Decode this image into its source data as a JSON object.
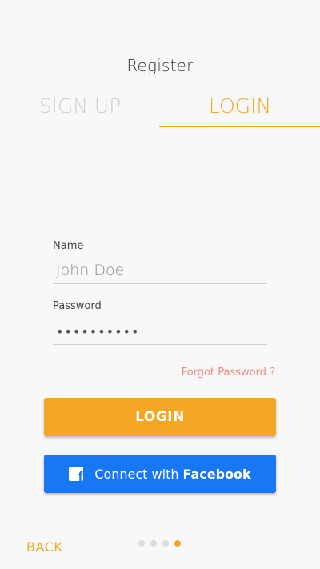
{
  "header": {
    "title": "Register"
  },
  "tabs": [
    {
      "label": "SIGN UP",
      "active": false
    },
    {
      "label": "LOGIN",
      "active": true
    }
  ],
  "form": {
    "name_label": "Name",
    "name_placeholder": "John Doe",
    "password_label": "Password",
    "password_value": "••••••••••",
    "forgot_link": "Forgot Password ?"
  },
  "buttons": {
    "login_label": "LOGIN",
    "facebook_prefix": "Connect with",
    "facebook_bold": "Facebook"
  },
  "footer": {
    "back_label": "BACK",
    "page_indicator": {
      "total": 4,
      "current": 4
    }
  },
  "colors": {
    "accent": "#f5a623",
    "facebook": "#1877f2",
    "link": "#f08a7e"
  },
  "icons": {
    "facebook": "facebook-icon"
  }
}
